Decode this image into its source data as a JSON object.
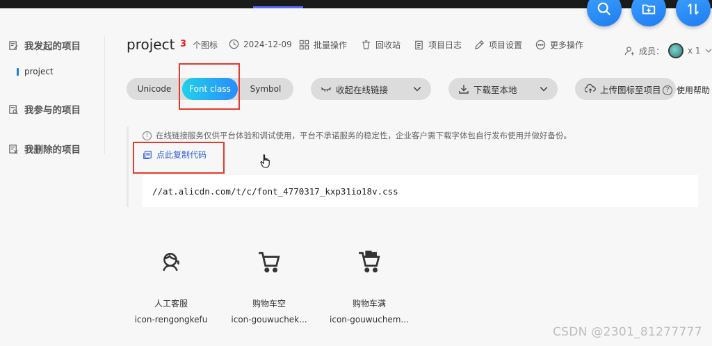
{
  "sidebar": {
    "items": [
      {
        "label": "我发起的项目",
        "icon": "edit-doc-icon"
      },
      {
        "label": "我参与的项目",
        "icon": "doc-search-icon"
      },
      {
        "label": "我删除的项目",
        "icon": "doc-delete-icon"
      }
    ],
    "sub_item": "project"
  },
  "header": {
    "title": "project",
    "icon_count": "3",
    "icon_count_label": "个图标",
    "date": "2024-12-09",
    "batch": "批量操作",
    "recycle": "回收站",
    "log": "项目日志",
    "settings": "项目设置",
    "more": "更多操作",
    "members_label": "成员：",
    "members_count": "x 1"
  },
  "tabs": [
    {
      "label": "Unicode",
      "active": false
    },
    {
      "label": "Font class",
      "active": true
    },
    {
      "label": "Symbol",
      "active": false
    }
  ],
  "toolbar": {
    "collapse_link": "收起在线链接",
    "download": "下载至本地",
    "upload": "上传图标至项目",
    "help": "使用帮助"
  },
  "notice": {
    "text": "在线链接服务仅供平台体验和调试使用，平台不承诺服务的稳定性，企业客户需下载字体包自行发布使用并做好备份。",
    "copy": "点此复制代码",
    "code": "//at.alicdn.com/t/c/font_4770317_kxp31io18v.css"
  },
  "icons": [
    {
      "name": "人工客服",
      "code": "icon-rengongkefu",
      "icon": "customer-service-icon"
    },
    {
      "name": "购物车空",
      "code": "icon-gouwuchek...",
      "icon": "cart-empty-icon"
    },
    {
      "name": "购物车满",
      "code": "icon-gouwuchem...",
      "icon": "cart-full-icon"
    }
  ],
  "watermark": "CSDN @2301_81277777",
  "colors": {
    "accent": "#1f7cf0",
    "highlight": "#e23b2e",
    "count": "#e02020"
  }
}
